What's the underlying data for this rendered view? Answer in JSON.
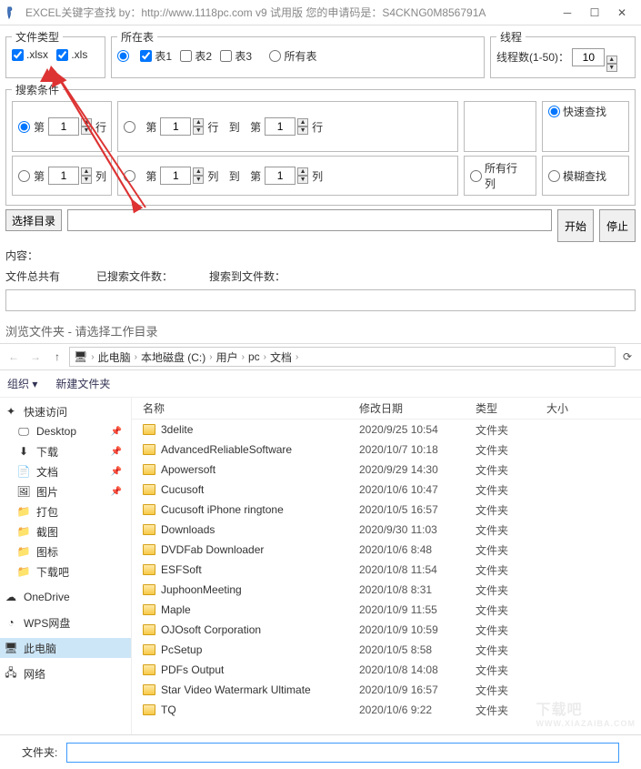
{
  "window": {
    "title": "EXCEL关键字查找  by：http://www.1118pc.com v9 试用版 您的申请码是：S4CKNG0M856791A"
  },
  "filetype": {
    "legend": "文件类型",
    "xlsx": ".xlsx",
    "xls": ".xls"
  },
  "table": {
    "legend": "所在表",
    "t1": "表1",
    "t2": "表2",
    "t3": "表3",
    "all": "所有表"
  },
  "thread": {
    "legend": "线程",
    "label": "线程数(1-50)：",
    "value": "10"
  },
  "search": {
    "legend": "搜索条件",
    "di": "第",
    "hang": "行",
    "lie": "列",
    "dao": "到",
    "r1a": "1",
    "r1b": "1",
    "r1c": "1",
    "r2a": "1",
    "r2b": "1",
    "r2c": "1",
    "allcols": "所有行列",
    "fast": "快速查找",
    "fuzzy": "模糊查找"
  },
  "dir": {
    "select": "选择目录",
    "start": "开始",
    "stop": "停止"
  },
  "status": {
    "content": "内容：",
    "total": "文件总共有",
    "searched": "已搜索文件数：",
    "found": "搜索到文件数："
  },
  "browse": {
    "title": "浏览文件夹 - 请选择工作目录",
    "crumbs": [
      "此电脑",
      "本地磁盘 (C:)",
      "用户",
      "pc",
      "文档"
    ],
    "org": "组织",
    "newfolder": "新建文件夹",
    "cols": {
      "name": "名称",
      "date": "修改日期",
      "type": "类型",
      "size": "大小"
    },
    "filelabel": "文件夹:"
  },
  "sidebar": {
    "quick": "快速访问",
    "items": [
      {
        "label": "Desktop",
        "pin": true
      },
      {
        "label": "下载",
        "pin": true
      },
      {
        "label": "文档",
        "pin": true
      },
      {
        "label": "图片",
        "pin": true
      },
      {
        "label": "打包"
      },
      {
        "label": "截图"
      },
      {
        "label": "图标"
      },
      {
        "label": "下载吧"
      }
    ],
    "onedrive": "OneDrive",
    "wps": "WPS网盘",
    "thispc": "此电脑",
    "network": "网络"
  },
  "files": [
    {
      "name": "3delite",
      "date": "2020/9/25 10:54",
      "type": "文件夹"
    },
    {
      "name": "AdvancedReliableSoftware",
      "date": "2020/10/7 10:18",
      "type": "文件夹"
    },
    {
      "name": "Apowersoft",
      "date": "2020/9/29 14:30",
      "type": "文件夹"
    },
    {
      "name": "Cucusoft",
      "date": "2020/10/6 10:47",
      "type": "文件夹"
    },
    {
      "name": "Cucusoft iPhone ringtone",
      "date": "2020/10/5 16:57",
      "type": "文件夹"
    },
    {
      "name": "Downloads",
      "date": "2020/9/30 11:03",
      "type": "文件夹"
    },
    {
      "name": "DVDFab Downloader",
      "date": "2020/10/6 8:48",
      "type": "文件夹"
    },
    {
      "name": "ESFSoft",
      "date": "2020/10/8 11:54",
      "type": "文件夹"
    },
    {
      "name": "JuphoonMeeting",
      "date": "2020/10/8 8:31",
      "type": "文件夹"
    },
    {
      "name": "Maple",
      "date": "2020/10/9 11:55",
      "type": "文件夹"
    },
    {
      "name": "OJOsoft Corporation",
      "date": "2020/10/9 10:59",
      "type": "文件夹"
    },
    {
      "name": "PcSetup",
      "date": "2020/10/5 8:58",
      "type": "文件夹"
    },
    {
      "name": "PDFs Output",
      "date": "2020/10/8 14:08",
      "type": "文件夹"
    },
    {
      "name": "Star Video Watermark Ultimate",
      "date": "2020/10/9 16:57",
      "type": "文件夹"
    },
    {
      "name": "TQ",
      "date": "2020/10/6 9:22",
      "type": "文件夹"
    }
  ],
  "watermark": {
    "main": "下载吧",
    "sub": "WWW.XIAZAIBA.COM"
  }
}
